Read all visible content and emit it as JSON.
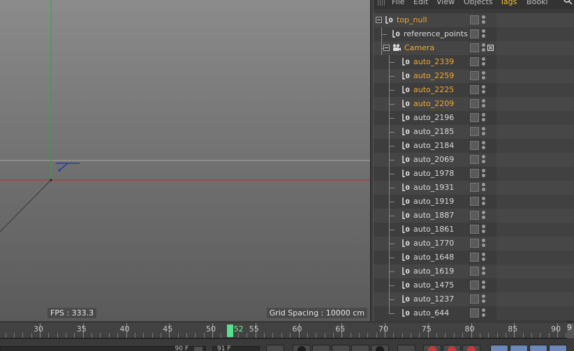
{
  "viewport": {
    "fps": "FPS : 333.3",
    "grid_spacing": "Grid Spacing : 10000 cm"
  },
  "object_manager": {
    "menu": [
      {
        "label": "File",
        "active": false
      },
      {
        "label": "Edit",
        "active": false
      },
      {
        "label": "View",
        "active": false
      },
      {
        "label": "Objects",
        "active": false
      },
      {
        "label": "Tags",
        "active": true
      },
      {
        "label": "Booki",
        "active": false
      }
    ],
    "objects": [
      {
        "name": "top_null",
        "depth": 0,
        "icon": "null-icon",
        "selected": true,
        "expanded": true
      },
      {
        "name": "reference_points",
        "depth": 1,
        "icon": "null-icon",
        "selected": false
      },
      {
        "name": "Camera",
        "depth": 1,
        "icon": "camera-icon",
        "selected": true,
        "expanded": true
      },
      {
        "name": "auto_2339",
        "depth": 2,
        "icon": "null-icon",
        "selected": true
      },
      {
        "name": "auto_2259",
        "depth": 2,
        "icon": "null-icon",
        "selected": true
      },
      {
        "name": "auto_2225",
        "depth": 2,
        "icon": "null-icon",
        "selected": true
      },
      {
        "name": "auto_2209",
        "depth": 2,
        "icon": "null-icon",
        "selected": true
      },
      {
        "name": "auto_2196",
        "depth": 2,
        "icon": "null-icon",
        "selected": false
      },
      {
        "name": "auto_2185",
        "depth": 2,
        "icon": "null-icon",
        "selected": false
      },
      {
        "name": "auto_2184",
        "depth": 2,
        "icon": "null-icon",
        "selected": false
      },
      {
        "name": "auto_2069",
        "depth": 2,
        "icon": "null-icon",
        "selected": false
      },
      {
        "name": "auto_1978",
        "depth": 2,
        "icon": "null-icon",
        "selected": false
      },
      {
        "name": "auto_1931",
        "depth": 2,
        "icon": "null-icon",
        "selected": false
      },
      {
        "name": "auto_1919",
        "depth": 2,
        "icon": "null-icon",
        "selected": false
      },
      {
        "name": "auto_1887",
        "depth": 2,
        "icon": "null-icon",
        "selected": false
      },
      {
        "name": "auto_1861",
        "depth": 2,
        "icon": "null-icon",
        "selected": false
      },
      {
        "name": "auto_1770",
        "depth": 2,
        "icon": "null-icon",
        "selected": false
      },
      {
        "name": "auto_1648",
        "depth": 2,
        "icon": "null-icon",
        "selected": false
      },
      {
        "name": "auto_1619",
        "depth": 2,
        "icon": "null-icon",
        "selected": false
      },
      {
        "name": "auto_1475",
        "depth": 2,
        "icon": "null-icon",
        "selected": false
      },
      {
        "name": "auto_1237",
        "depth": 2,
        "icon": "null-icon",
        "selected": false
      },
      {
        "name": "auto_644",
        "depth": 2,
        "icon": "null-icon",
        "selected": false
      }
    ]
  },
  "timeline": {
    "ticks": [
      "30",
      "35",
      "40",
      "45",
      "50",
      "55",
      "60",
      "65",
      "70",
      "75",
      "80",
      "85",
      "90"
    ],
    "current_frame": "52",
    "right_fragment": "9",
    "field_left": "90 F",
    "field_right": "91 F"
  },
  "colors": {
    "selected_text": "#f0a830",
    "active_menu": "#f0c030",
    "playhead": "#58e08a",
    "y_axis": "#2ea836",
    "x_axis": "#c0302e"
  }
}
